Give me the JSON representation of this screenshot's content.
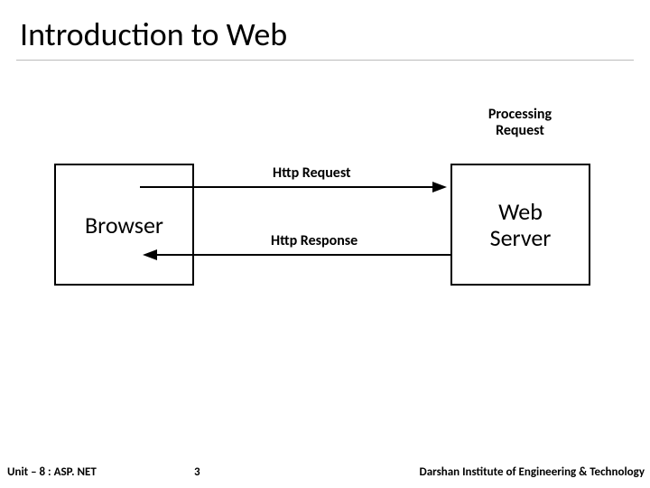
{
  "title": "Introduction to Web",
  "diagram": {
    "browser_label": "Browser",
    "server_label": "Web\nServer",
    "processing_caption": "Processing\nRequest",
    "request_label": "Http Request",
    "response_label": "Http Response"
  },
  "footer": {
    "left": "Unit – 8 : ASP. NET",
    "page": "3",
    "right": "Darshan Institute of Engineering & Technology"
  }
}
